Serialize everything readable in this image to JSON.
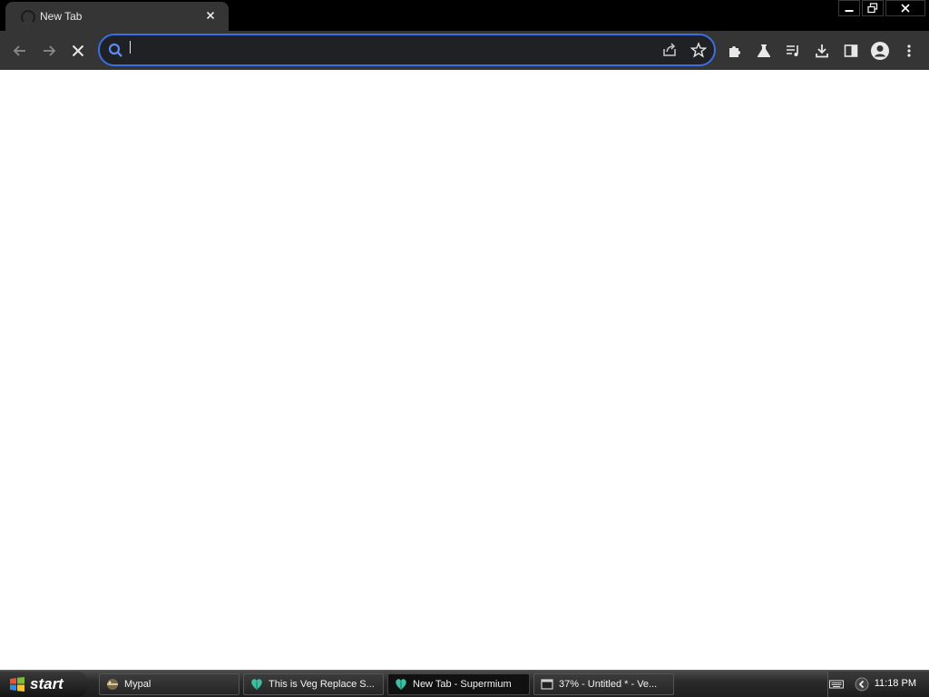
{
  "browser": {
    "tab": {
      "title": "New Tab"
    },
    "omnibox": {
      "value": "",
      "placeholder": ""
    }
  },
  "icons": {
    "tab_spinner": "loading-spinner-icon",
    "tab_close": "close-icon",
    "back": "back-arrow-icon",
    "forward": "forward-arrow-icon",
    "stop": "stop-icon",
    "search": "search-icon",
    "share": "share-icon",
    "bookmark": "star-icon",
    "extensions": "puzzle-icon",
    "labs": "flask-icon",
    "reading_list": "media-queue-icon",
    "downloads": "download-icon",
    "side_panel": "side-panel-icon",
    "profile": "profile-avatar-icon",
    "menu": "kebab-menu-icon",
    "minimize": "minimize-icon",
    "restore": "restore-icon",
    "close_window": "close-icon"
  },
  "taskbar": {
    "start_label": "start",
    "tasks": [
      {
        "label": "Mypal",
        "active": false
      },
      {
        "label": "This is Veg Replace S...",
        "active": false
      },
      {
        "label": "New Tab - Supermium",
        "active": true
      },
      {
        "label": "37% - Untitled * - Ve...",
        "active": false
      }
    ],
    "clock": "11:18 PM"
  },
  "colors": {
    "accent": "#3c6ee6",
    "toolbar": "#353535",
    "page": "#ffffff"
  }
}
